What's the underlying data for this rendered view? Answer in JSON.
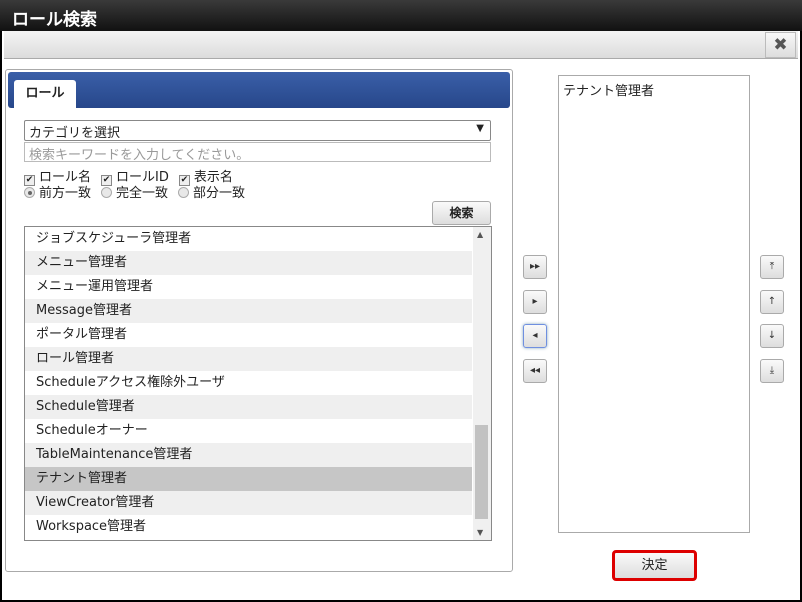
{
  "title": "ロール検索",
  "close_label": "✖",
  "tab": "ロール",
  "category_select": "カテゴリを選択",
  "keyword_placeholder": "検索キーワードを入力してください。",
  "checkboxes": [
    {
      "label": "ロール名",
      "checked": true
    },
    {
      "label": "ロールID",
      "checked": true
    },
    {
      "label": "表示名",
      "checked": true
    }
  ],
  "radios": [
    {
      "label": "前方一致",
      "selected": true
    },
    {
      "label": "完全一致",
      "selected": false
    },
    {
      "label": "部分一致",
      "selected": false
    }
  ],
  "search_button": "検索",
  "available": [
    "ジョブスケジューラ管理者",
    "メニュー管理者",
    "メニュー運用管理者",
    "Message管理者",
    "ポータル管理者",
    "ロール管理者",
    "Scheduleアクセス権除外ユーザ",
    "Schedule管理者",
    "Scheduleオーナー",
    "TableMaintenance管理者",
    "テナント管理者",
    "ViewCreator管理者",
    "Workspace管理者"
  ],
  "selected_available": "テナント管理者",
  "selected_list": [
    "テナント管理者"
  ],
  "move_buttons": [
    "▸▸",
    "▸",
    "◂",
    "◂◂"
  ],
  "order_buttons": [
    "⤒",
    "↑",
    "↓",
    "⤓"
  ],
  "ok_button": "決定"
}
